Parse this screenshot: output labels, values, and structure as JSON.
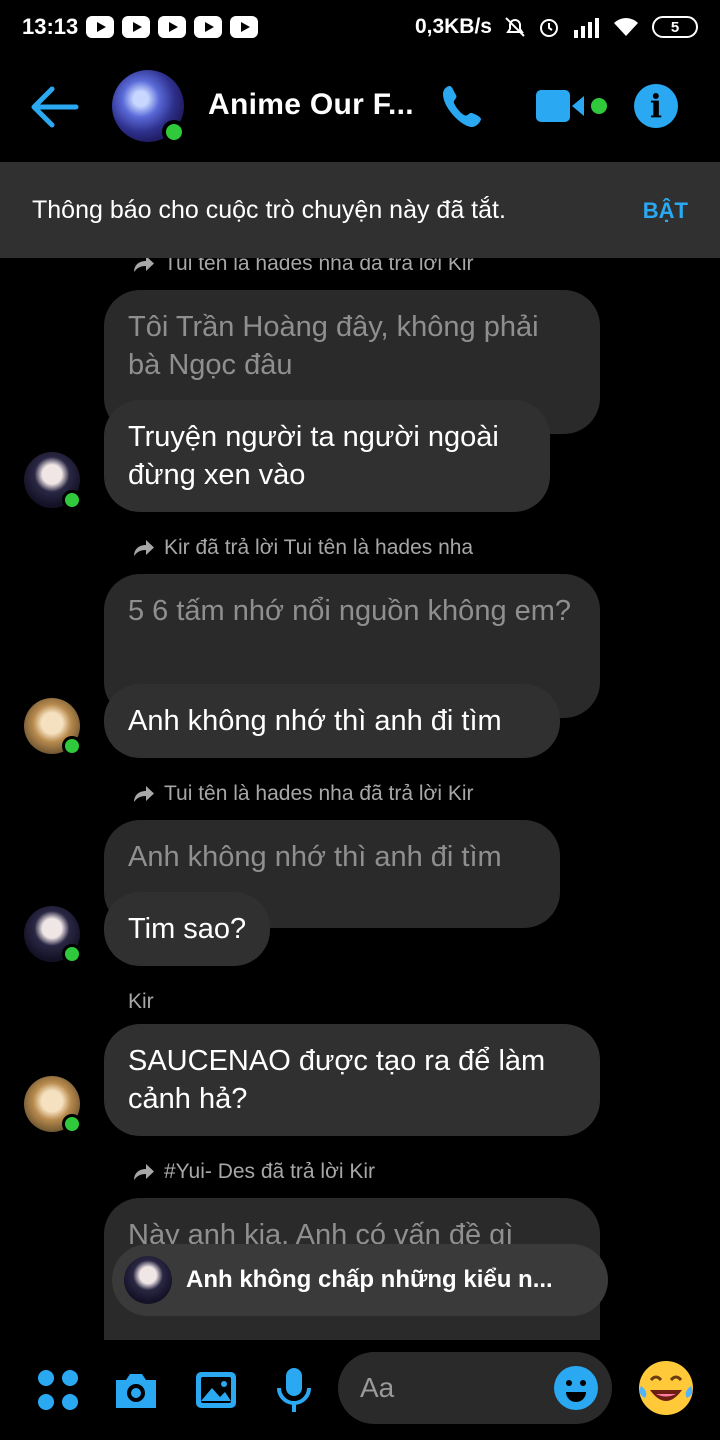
{
  "status_bar": {
    "time": "13:13",
    "data_rate": "0,3KB/s",
    "battery": "5"
  },
  "header": {
    "title": "Anime Our F..."
  },
  "notice": {
    "text": "Thông báo cho cuộc trò chuyện này đã tắt.",
    "action": "BẬT"
  },
  "messages": {
    "m1_meta": "Tui tên là hades nha đã trả lời Kir",
    "m1_quoted": "Tôi Trần Hoàng đây, không phải bà Ngọc đâu",
    "m1_text": "Truyện người ta người ngoài đừng xen vào",
    "m2_meta": "Kir đã trả lời Tui tên là hades nha",
    "m2_quoted": "5 6 tấm nhớ nổi nguồn không em?",
    "m2_text": "Anh không nhớ thì anh đi tìm",
    "m3_meta": "Tui tên là hades nha đã trả lời Kir",
    "m3_quoted": "Anh không nhớ thì anh đi tìm",
    "m3_text": "Tim sao?",
    "m4_sender": "Kir",
    "m4_text": "SAUCENAO được tạo ra để làm cảnh hả?",
    "m5_meta": "#Yui- Des đã trả lời Kir",
    "m5_quoted": "Này anh kia. Anh có vấn đề gì"
  },
  "toast": {
    "text": "Anh không chấp những kiểu n..."
  },
  "composer": {
    "placeholder": "Aa"
  },
  "colors": {
    "accent": "#2aa8f2",
    "online": "#31c93c",
    "bubble": "#303030"
  }
}
